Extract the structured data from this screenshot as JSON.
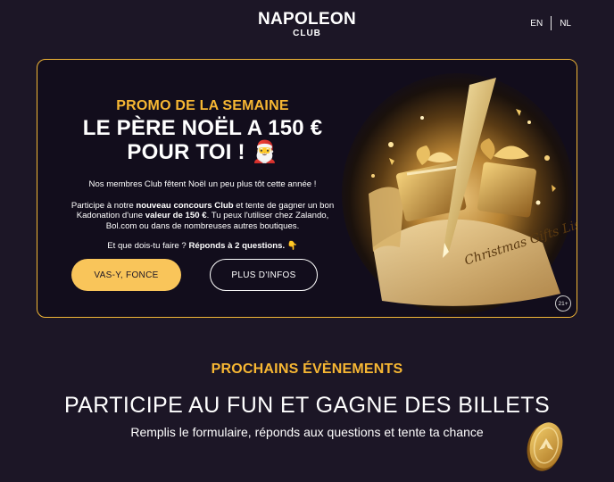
{
  "header": {
    "logo_main": "NAPOLEON",
    "logo_sub": "CLUB",
    "languages": [
      "EN",
      "NL"
    ]
  },
  "promo": {
    "kicker": "PROMO DE LA SEMAINE",
    "title_line1": "LE PÈRE NOËL A 150 €",
    "title_line2": "POUR TOI ! 🎅",
    "p1": "Nos membres Club fêtent Noël un peu plus tôt cette année !",
    "p2_a": "Participe à notre ",
    "p2_b": "nouveau concours Club",
    "p2_c": " et tente de gagner un bon Kadonation d'une ",
    "p2_d": "valeur de 150 €",
    "p2_e": ". Tu peux l'utiliser chez Zalando, Bol.com ou dans de nombreuses autres boutiques.",
    "p3_a": "Et que dois-tu faire ? ",
    "p3_b": "Réponds à 2 questions.",
    "p3_c": " 👇",
    "primary_button": "VAS-Y, FONCE",
    "secondary_button": "PLUS D'INFOS",
    "image_caption": "Christmas Gifts List",
    "age_badge": "21+"
  },
  "events": {
    "kicker": "PROCHAINS ÉVÈNEMENTS",
    "title": "PARTICIPE AU FUN ET GAGNE DES BILLETS",
    "subtitle": "Remplis le formulaire, réponds aux questions et tente ta chance"
  },
  "colors": {
    "background": "#1c1626",
    "accent_gold": "#f7b733",
    "button_gold": "#f9c55a",
    "card_border": "#f2b736"
  }
}
